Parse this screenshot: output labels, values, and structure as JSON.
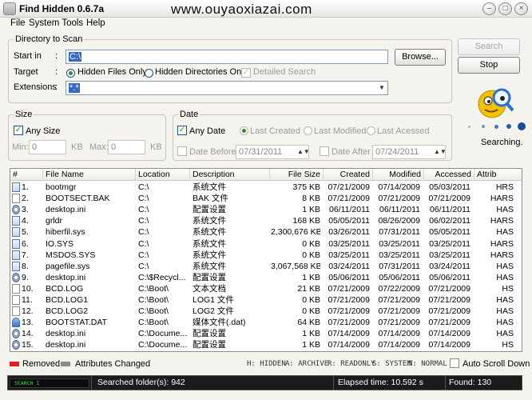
{
  "window": {
    "title": "Find Hidden 0.6.7a",
    "watermark": "www.ouyaoxiazai.com"
  },
  "menu": [
    "File",
    "System Tools",
    "Help"
  ],
  "directory_group": {
    "legend": "Directory to Scan",
    "start_in_label": "Start in",
    "start_in_value": "C:\\",
    "browse_label": "Browse...",
    "target_label": "Target",
    "target_options": [
      "Hidden Files Only",
      "Hidden Directories Only"
    ],
    "target_selected": "Hidden Files Only",
    "detailed_search_label": "Detailed Search",
    "extensions_label": "Extensions",
    "extensions_value": "*.*"
  },
  "actions": {
    "search_label": "Search",
    "stop_label": "Stop",
    "status_text": "Searching."
  },
  "size_group": {
    "legend": "Size",
    "any_size_label": "Any Size",
    "any_size_checked": true,
    "min_label": "Min:",
    "min_value": "0",
    "min_unit": "KB",
    "max_label": "Max:",
    "max_value": "0",
    "max_unit": "KB"
  },
  "date_group": {
    "legend": "Date",
    "any_date_label": "Any Date",
    "any_date_checked": true,
    "date_modes": [
      "Last Created",
      "Last Modified",
      "Last Acessed"
    ],
    "date_before_label": "Date Before",
    "date_before_value": "07/31/2011",
    "date_after_label": "Date After",
    "date_after_value": "07/24/2011"
  },
  "table": {
    "columns": [
      "#",
      "File Name",
      "Location",
      "Description",
      "File Size",
      "Created",
      "Modified",
      "Accessed",
      "Attrib"
    ],
    "rows": [
      {
        "num": "1.",
        "name": "bootmgr",
        "loc": "C:\\",
        "desc": "系统文件",
        "size": "375 KB",
        "created": "07/21/2009",
        "modified": "07/14/2009",
        "accessed": "05/03/2011",
        "attrib": "HRS",
        "icon": "sys"
      },
      {
        "num": "2.",
        "name": "BOOTSECT.BAK",
        "loc": "C:\\",
        "desc": "BAK 文件",
        "size": "8 KB",
        "created": "07/21/2009",
        "modified": "07/21/2009",
        "accessed": "07/21/2009",
        "attrib": "HARS",
        "icon": "doc"
      },
      {
        "num": "3.",
        "name": "desktop.ini",
        "loc": "C:\\",
        "desc": "配置设置",
        "size": "1 KB",
        "created": "06/11/2011",
        "modified": "06/11/2011",
        "accessed": "06/11/2011",
        "attrib": "HAS",
        "icon": "gear"
      },
      {
        "num": "4.",
        "name": "grldr",
        "loc": "C:\\",
        "desc": "系统文件",
        "size": "168 KB",
        "created": "05/05/2011",
        "modified": "08/26/2009",
        "accessed": "06/02/2011",
        "attrib": "HARS",
        "icon": "sys"
      },
      {
        "num": "5.",
        "name": "hiberfil.sys",
        "loc": "C:\\",
        "desc": "系统文件",
        "size": "2,300,676 KB",
        "created": "03/26/2011",
        "modified": "07/31/2011",
        "accessed": "05/05/2011",
        "attrib": "HAS",
        "icon": "sys"
      },
      {
        "num": "6.",
        "name": "IO.SYS",
        "loc": "C:\\",
        "desc": "系统文件",
        "size": "0 KB",
        "created": "03/25/2011",
        "modified": "03/25/2011",
        "accessed": "03/25/2011",
        "attrib": "HARS",
        "icon": "sys"
      },
      {
        "num": "7.",
        "name": "MSDOS.SYS",
        "loc": "C:\\",
        "desc": "系统文件",
        "size": "0 KB",
        "created": "03/25/2011",
        "modified": "03/25/2011",
        "accessed": "03/25/2011",
        "attrib": "HARS",
        "icon": "sys"
      },
      {
        "num": "8.",
        "name": "pagefile.sys",
        "loc": "C:\\",
        "desc": "系统文件",
        "size": "3,067,568 KB",
        "created": "03/24/2011",
        "modified": "07/31/2011",
        "accessed": "03/24/2011",
        "attrib": "HAS",
        "icon": "sys"
      },
      {
        "num": "9.",
        "name": "desktop.ini",
        "loc": "C:\\$Recycl...",
        "desc": "配置设置",
        "size": "1 KB",
        "created": "05/06/2011",
        "modified": "05/06/2011",
        "accessed": "05/06/2011",
        "attrib": "HAS",
        "icon": "gear"
      },
      {
        "num": "10.",
        "name": "BCD.LOG",
        "loc": "C:\\Boot\\",
        "desc": "文本文档",
        "size": "21 KB",
        "created": "07/21/2009",
        "modified": "07/22/2009",
        "accessed": "07/21/2009",
        "attrib": "HS",
        "icon": "doc"
      },
      {
        "num": "11.",
        "name": "BCD.LOG1",
        "loc": "C:\\Boot\\",
        "desc": "LOG1 文件",
        "size": "0 KB",
        "created": "07/21/2009",
        "modified": "07/21/2009",
        "accessed": "07/21/2009",
        "attrib": "HAS",
        "icon": "doc"
      },
      {
        "num": "12.",
        "name": "BCD.LOG2",
        "loc": "C:\\Boot\\",
        "desc": "LOG2 文件",
        "size": "0 KB",
        "created": "07/21/2009",
        "modified": "07/21/2009",
        "accessed": "07/21/2009",
        "attrib": "HAS",
        "icon": "doc"
      },
      {
        "num": "13.",
        "name": "BOOTSTAT.DAT",
        "loc": "C:\\Boot\\",
        "desc": "媒体文件(.dat)",
        "size": "64 KB",
        "created": "07/21/2009",
        "modified": "07/21/2009",
        "accessed": "07/21/2009",
        "attrib": "HAS",
        "icon": "media"
      },
      {
        "num": "14.",
        "name": "desktop.ini",
        "loc": "C:\\Docume...",
        "desc": "配置设置",
        "size": "1 KB",
        "created": "07/14/2009",
        "modified": "07/14/2009",
        "accessed": "07/14/2009",
        "attrib": "HAS",
        "icon": "gear"
      },
      {
        "num": "15.",
        "name": "desktop.ini",
        "loc": "C:\\Docume...",
        "desc": "配置设置",
        "size": "1 KB",
        "created": "07/14/2009",
        "modified": "07/14/2009",
        "accessed": "07/14/2009",
        "attrib": "HS",
        "icon": "gear"
      }
    ]
  },
  "legend": {
    "removed_label": "Removed",
    "removed_color": "#e21d1d",
    "changed_label": "Attributes Changed",
    "changed_color": "#8a8a8a",
    "attr_key": [
      "H: HIDDEN",
      "A: ARCHIVE",
      "R: READONLY",
      "S: SYSTEM",
      "N: NORMAL"
    ],
    "auto_scroll_label": "Auto Scroll Down"
  },
  "statusbar": {
    "mode": "SEARCH I",
    "searched": "Searched folder(s): 942",
    "elapsed": "Elapsed time: 10.592 s",
    "found": "Found:  130"
  },
  "colors": {
    "accent_blue": "#316ac5",
    "status_green": "#3fd23f"
  }
}
